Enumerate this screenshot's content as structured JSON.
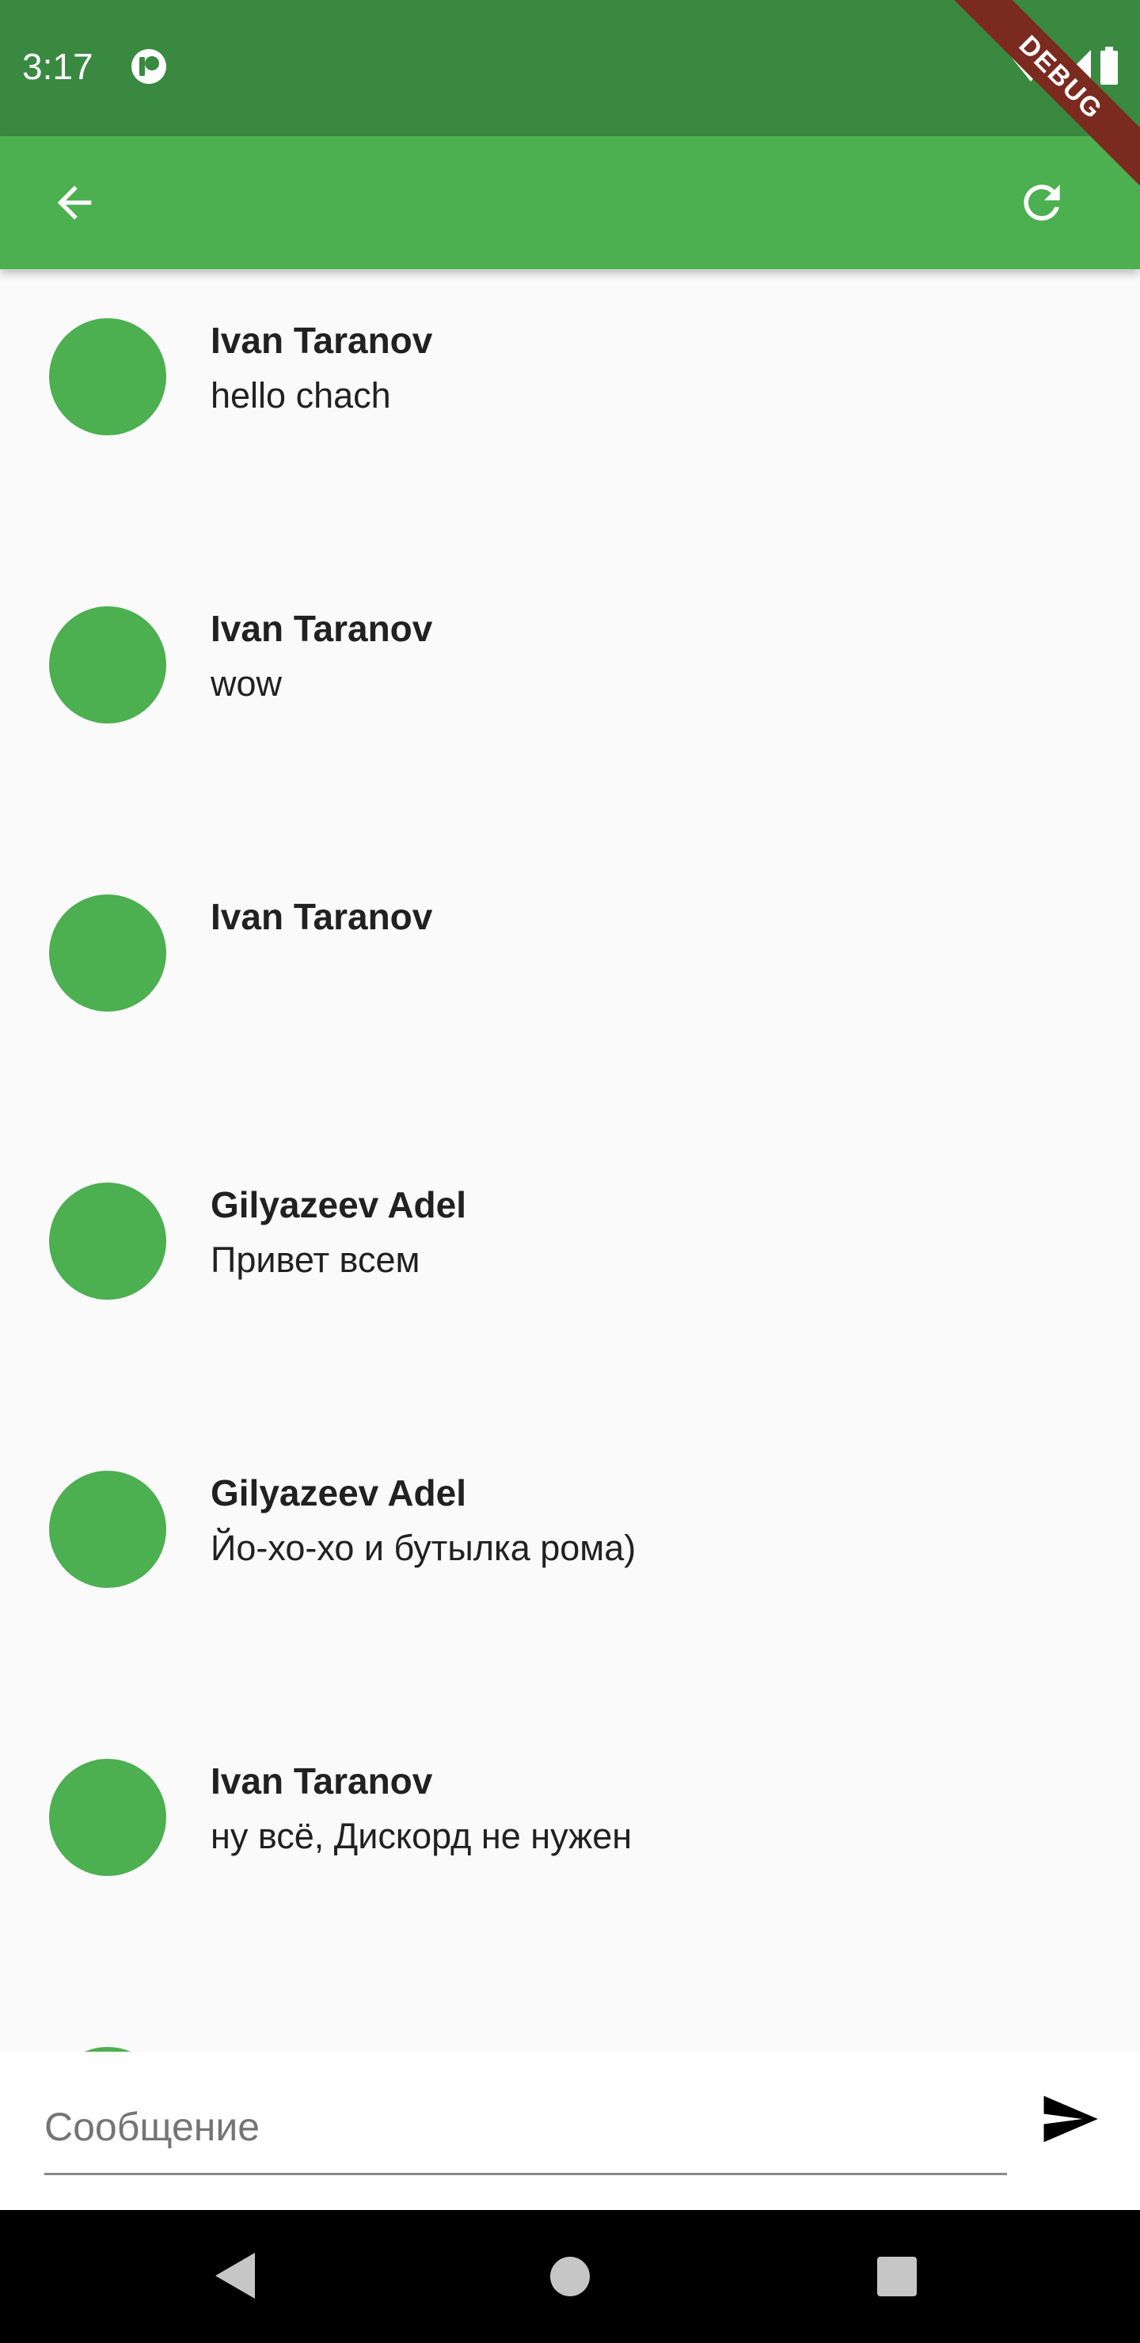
{
  "status_bar": {
    "time": "3:17",
    "icons": [
      "notification-app-icon",
      "wifi-icon",
      "signal-icon",
      "battery-icon"
    ]
  },
  "debug_banner": "DEBUG",
  "app_bar": {
    "color": "#4caf50",
    "back_icon": "arrow-back-icon",
    "refresh_icon": "refresh-icon"
  },
  "messages": [
    {
      "author": "Ivan Taranov",
      "text": "hello chach"
    },
    {
      "author": "Ivan Taranov",
      "text": "wow"
    },
    {
      "author": "Ivan Taranov",
      "text": ""
    },
    {
      "author": "Gilyazeev Adel",
      "text": "Привет всем"
    },
    {
      "author": "Gilyazeev Adel",
      "text": "Йо-хо-хо и бутылка рома)"
    },
    {
      "author": "Ivan Taranov",
      "text": "ну всё, Дискорд не нужен"
    }
  ],
  "composer": {
    "placeholder": "Сообщение",
    "value": "",
    "send_icon": "send-icon"
  },
  "colors": {
    "status_bar": "#3a8940",
    "accent": "#4caf50",
    "background": "#fafafa"
  }
}
